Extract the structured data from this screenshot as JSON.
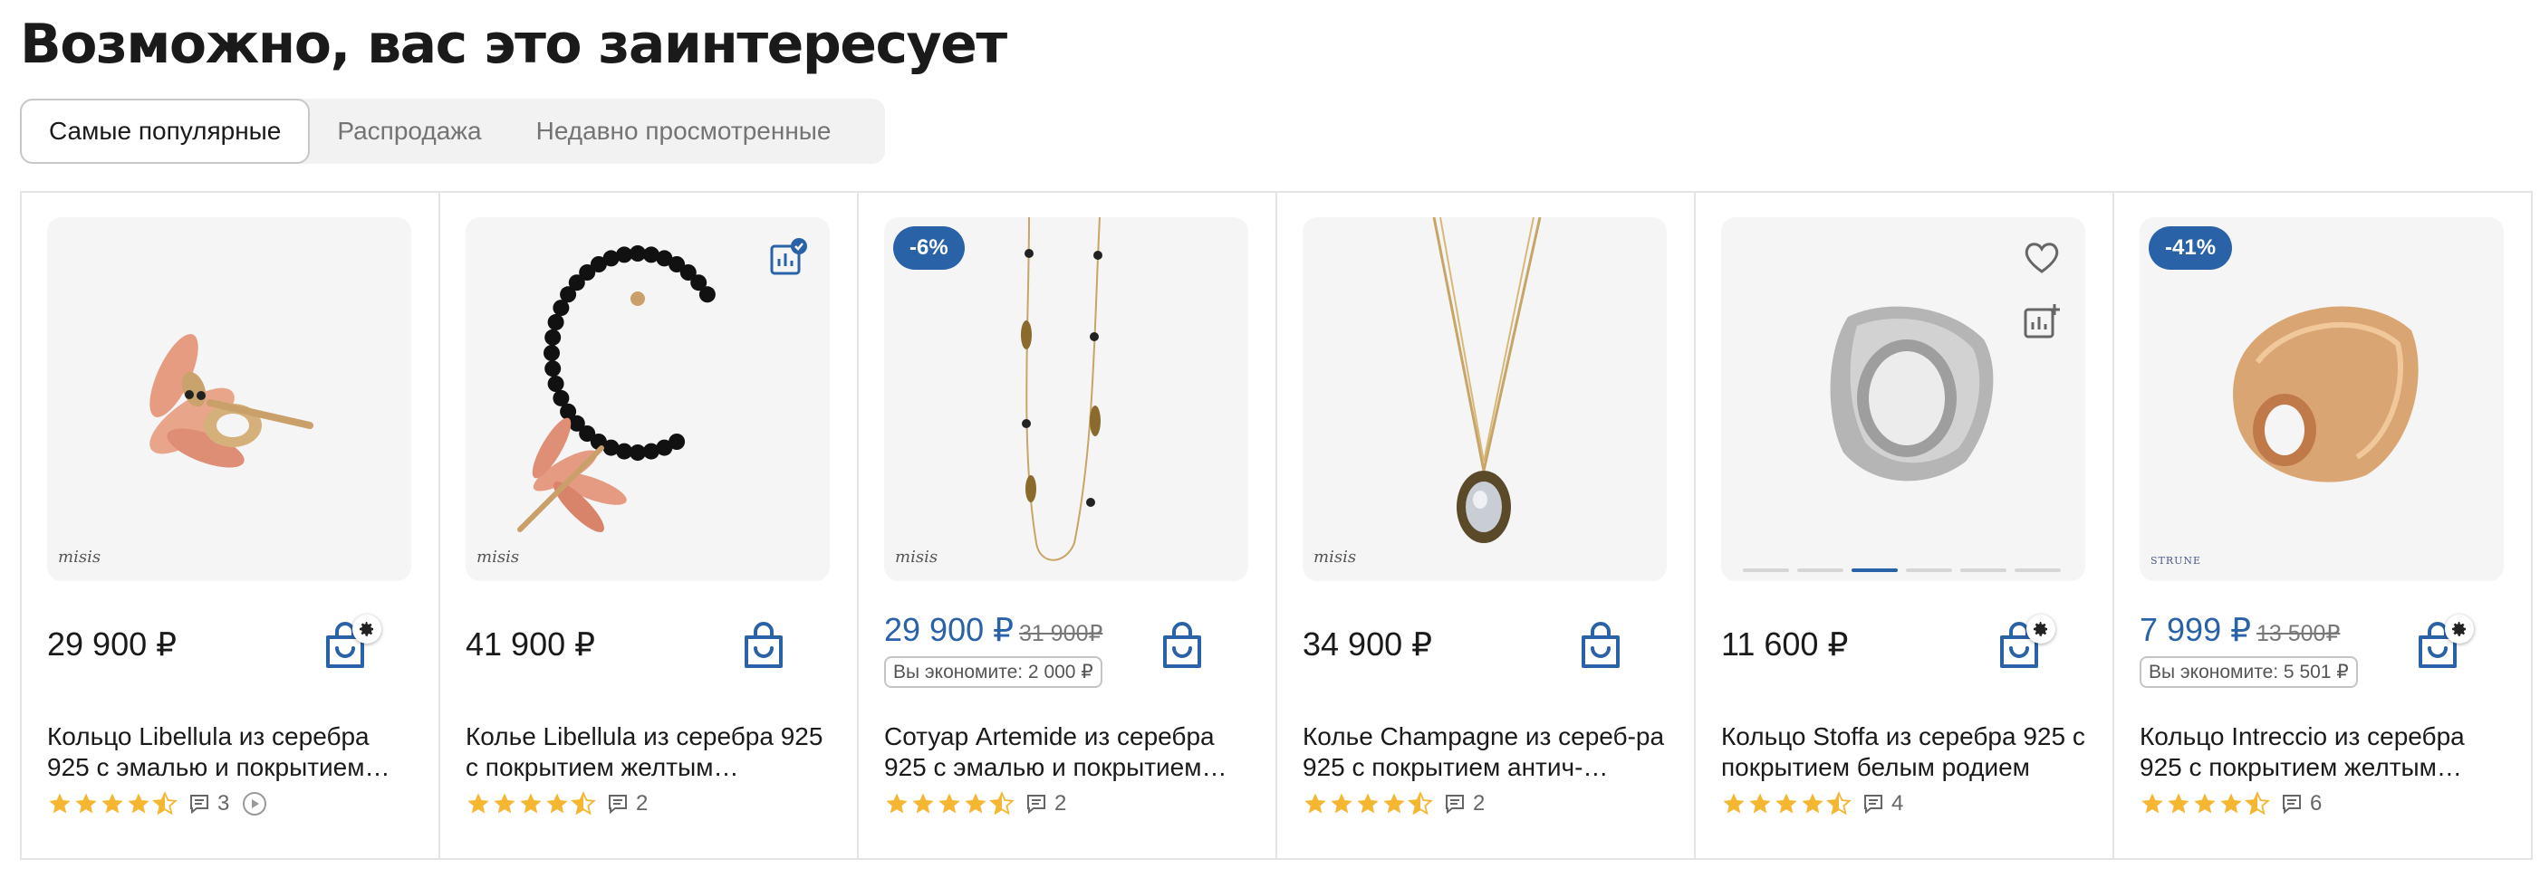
{
  "section_title": "Возможно, вас это заинтересует",
  "tabs": [
    {
      "label": "Самые популярные",
      "active": true
    },
    {
      "label": "Распродажа",
      "active": false
    },
    {
      "label": "Недавно просмотренные",
      "active": false
    }
  ],
  "colors": {
    "accent": "#2a62a8",
    "star": "#f5b731"
  },
  "products": [
    {
      "title": "Кольцо Libellula из серебра 925 с эмалью и покрытием…",
      "price": "29 900 ₽",
      "reviews": "3",
      "brand": "misis",
      "has_video_icon": true
    },
    {
      "title": "Колье Libellula из серебра 925 с покрытием желтым…",
      "price": "41 900 ₽",
      "reviews": "2",
      "brand": "misis"
    },
    {
      "title": "Сотуар Artemide из серебра 925 с эмалью и покрытием…",
      "price": "29 900 ₽",
      "old_price": "31 900₽",
      "saving": "Вы экономите: 2 000 ₽",
      "discount_badge": "-6%",
      "reviews": "2",
      "brand": "misis"
    },
    {
      "title": "Колье Champagne из сереб-ра 925 с покрытием антич-…",
      "price": "34 900 ₽",
      "reviews": "2",
      "brand": "misis"
    },
    {
      "title": "Кольцо Stoffa из серебра 925 с покрытием белым родием",
      "price": "11 600 ₽",
      "reviews": "4",
      "carousel": {
        "count": 6,
        "active": 3
      }
    },
    {
      "title": "Кольцо Intreccio из серебра 925 с покрытием желтым…",
      "price": "7 999 ₽",
      "old_price": "13 500₽",
      "saving": "Вы экономите: 5 501 ₽",
      "discount_badge": "-41%",
      "reviews": "6",
      "brand": "STRUNE"
    }
  ]
}
